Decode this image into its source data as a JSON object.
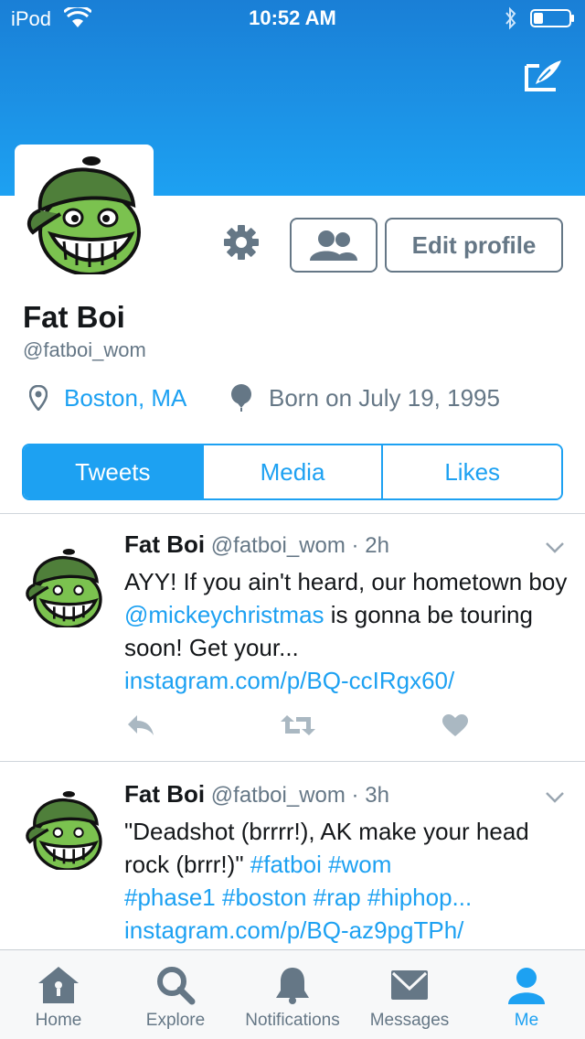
{
  "status_bar": {
    "carrier": "iPod",
    "time": "10:52 AM"
  },
  "colors": {
    "accent": "#1da1f2",
    "secondary_text": "#657786",
    "primary_text": "#14171a"
  },
  "profile": {
    "name": "Fat Boi",
    "handle": "@fatboi_wom",
    "location": "Boston, MA",
    "birth": "Born on July 19, 1995",
    "edit_button": "Edit profile"
  },
  "tabs": [
    {
      "label": "Tweets",
      "active": true
    },
    {
      "label": "Media",
      "active": false
    },
    {
      "label": "Likes",
      "active": false
    }
  ],
  "tweets": [
    {
      "name": "Fat Boi",
      "handle": "@fatboi_wom",
      "dot": "·",
      "time": "2h",
      "text_1": "AYY! If you ain't heard, our hometown boy ",
      "mention": "@mickeychristmas",
      "text_2": " is gonna be touring soon! Get your...",
      "link": "instagram.com/p/BQ-ccIRgx60/"
    },
    {
      "name": "Fat Boi",
      "handle": "@fatboi_wom",
      "dot": "·",
      "time": "3h",
      "text_1": "\"Deadshot (brrrr!), AK make your head rock (brrr!)\" ",
      "hashtags_1": "#fatboi #wom",
      "hashtags_2": "#phase1 #boston #rap #hiphop...",
      "link": "instagram.com/p/BQ-az9pgTPh/"
    }
  ],
  "tab_bar": [
    {
      "label": "Home",
      "icon": "home-icon"
    },
    {
      "label": "Explore",
      "icon": "search-icon"
    },
    {
      "label": "Notifications",
      "icon": "bell-icon"
    },
    {
      "label": "Messages",
      "icon": "envelope-icon"
    },
    {
      "label": "Me",
      "icon": "person-icon",
      "active": true
    }
  ]
}
